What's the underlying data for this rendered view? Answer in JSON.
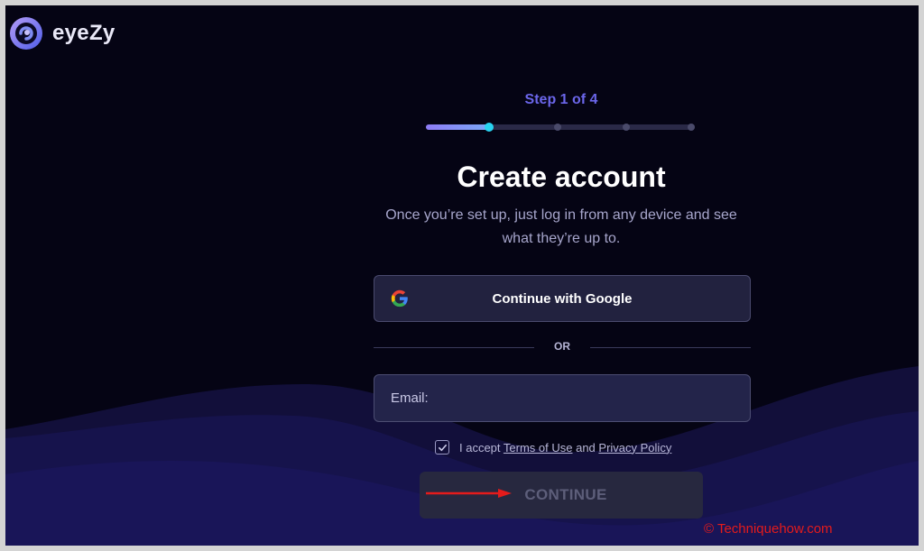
{
  "brand": {
    "name": "eyeZy"
  },
  "progress": {
    "label": "Step 1 of 4",
    "current_step": 1,
    "total_steps": 4,
    "fill_fraction": 0.23
  },
  "heading": {
    "title": "Create account",
    "subtitle": "Once you’re set up, just log in from any device and see what they’re up to."
  },
  "google_button": {
    "label": "Continue with Google"
  },
  "divider": {
    "label": "OR"
  },
  "email": {
    "placeholder": "Email:",
    "value": ""
  },
  "terms": {
    "checked": true,
    "prefix": "I accept ",
    "terms_link": "Terms of Use",
    "conjunction": " and ",
    "privacy_link": "Privacy Policy"
  },
  "continue_button": {
    "label": "CONTINUE"
  },
  "watermark": {
    "text": "© Techniquehow.com"
  },
  "colors": {
    "background": "#050414",
    "accent": "#6b66ea",
    "progress_dot_active": "#28d3f0",
    "button_bg": "#22223f",
    "annotation_arrow": "#e51b1b"
  },
  "icons": {
    "logo": "eyezy-logo-icon",
    "google": "google-icon",
    "checkbox": "checkmark-icon",
    "annotation": "red-arrow-icon"
  }
}
